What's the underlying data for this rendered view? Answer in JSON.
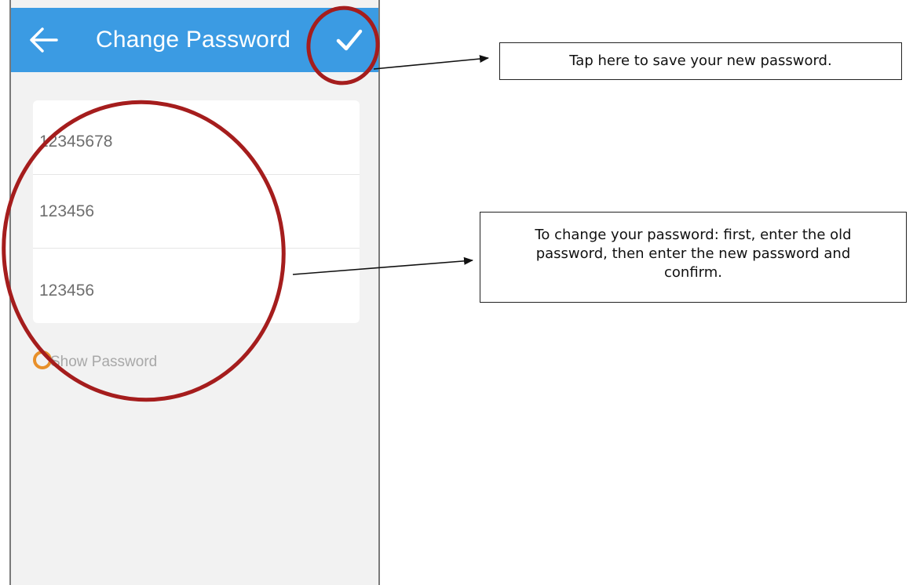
{
  "app_bar": {
    "title": "Change Password",
    "back_icon": "arrow-left-icon",
    "save_icon": "checkmark-icon",
    "color": "#3b9be3"
  },
  "form": {
    "fields": [
      {
        "value": "12345678"
      },
      {
        "value": "123456"
      },
      {
        "value": "123456"
      }
    ],
    "show_password": {
      "label": "Show Password",
      "checked": false,
      "color": "#e8902a"
    }
  },
  "annotations": {
    "save_callout": "Tap here to save your new password.",
    "change_callout": "To change your password: first, enter the old password, then enter the new password and confirm.",
    "highlight_color": "#a51d1d"
  }
}
